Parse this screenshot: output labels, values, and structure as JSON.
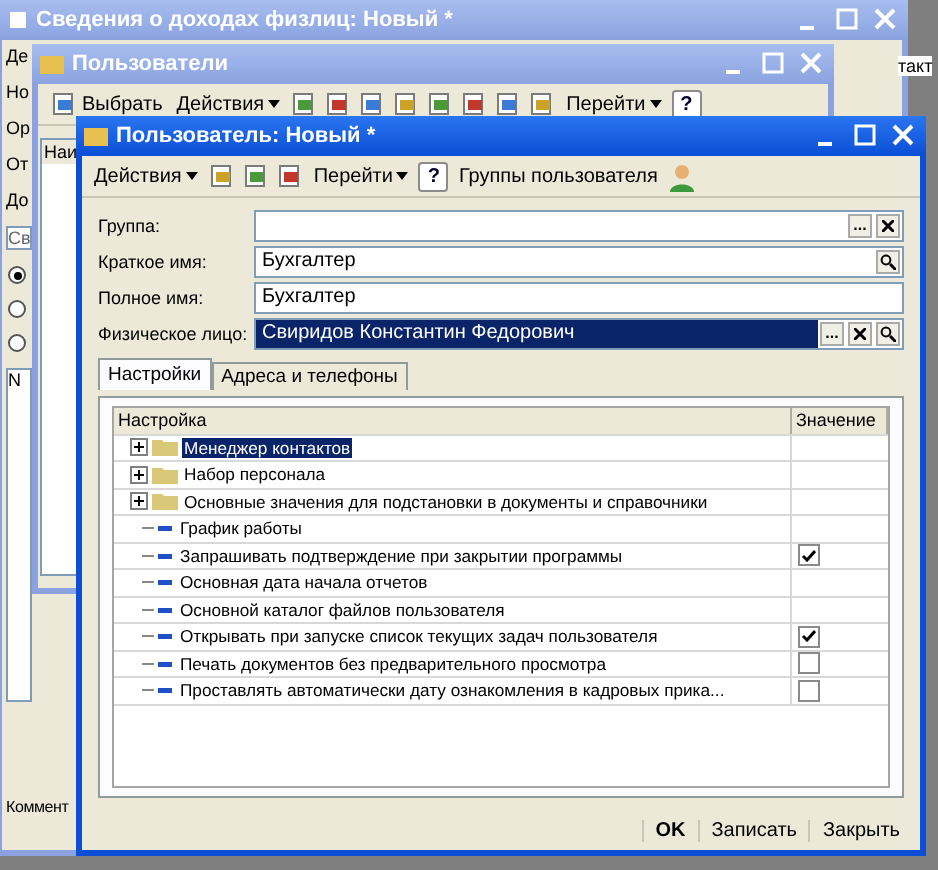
{
  "back_window": {
    "title": "Сведения о доходах физлиц: Новый *",
    "toolbar_label": "Де",
    "side_labels": [
      "Но",
      "Ор",
      "От",
      "До"
    ],
    "select_label": "Св",
    "radios": [
      {
        "selected": true
      },
      {
        "selected": false
      },
      {
        "selected": false
      }
    ],
    "list_label": "N",
    "comment_label": "Коммент",
    "right_label": "такт"
  },
  "users_window": {
    "title": "Пользователи",
    "toolbar": [
      {
        "kind": "select",
        "label": "Выбрать"
      },
      {
        "kind": "menu",
        "label": "Действия"
      },
      {
        "kind": "icon"
      },
      {
        "kind": "icon"
      },
      {
        "kind": "icon"
      },
      {
        "kind": "icon"
      },
      {
        "kind": "icon"
      },
      {
        "kind": "icon"
      },
      {
        "kind": "icon"
      },
      {
        "kind": "icon"
      },
      {
        "kind": "menu",
        "label": "Перейти"
      },
      {
        "kind": "help",
        "label": "?"
      }
    ],
    "column": "Наи"
  },
  "user_window": {
    "title": "Пользователь: Новый *",
    "toolbar": [
      {
        "kind": "menu",
        "label": "Действия"
      },
      {
        "kind": "icon"
      },
      {
        "kind": "icon"
      },
      {
        "kind": "icon"
      },
      {
        "kind": "menu",
        "label": "Перейти"
      },
      {
        "kind": "help",
        "label": "?"
      },
      {
        "kind": "text",
        "label": "Группы пользователя"
      },
      {
        "kind": "person"
      }
    ],
    "fields": [
      {
        "label": "Группа:",
        "selected": false,
        "buttons": [
          {
            "kind": "choose",
            "label": "..."
          },
          {
            "kind": "clear"
          }
        ]
      },
      {
        "label": "Краткое имя:",
        "value": "Бухгалтер",
        "selected": false,
        "buttons": [
          {
            "kind": "open"
          }
        ]
      },
      {
        "label": "Полное имя:",
        "value": "Бухгалтер",
        "selected": false
      },
      {
        "label": "Физическое лицо:",
        "value": "Свиридов Константин Федорович",
        "selected": true,
        "buttons": [
          {
            "kind": "choose",
            "label": "..."
          },
          {
            "kind": "clear"
          },
          {
            "kind": "open"
          }
        ]
      }
    ],
    "tabs": [
      {
        "label": "Настройки",
        "selected": true
      },
      {
        "label": "Адреса и телефоны",
        "selected": false
      }
    ],
    "table": {
      "columns": [
        "Настройка",
        "Значение"
      ],
      "rows": [
        {
          "kind": "group",
          "label": "Менеджер контактов",
          "expanded": false,
          "selected": true
        },
        {
          "kind": "group",
          "label": "Набор персонала",
          "expanded": false,
          "selected": false
        },
        {
          "kind": "group",
          "label": "Основные значения для подстановки в документы и справочники",
          "expanded": false,
          "selected": false
        },
        {
          "kind": "param",
          "label": "График работы",
          "selected": false
        },
        {
          "kind": "param",
          "label": "Запрашивать подтверждение при закрытии программы",
          "checked": true,
          "selected": false
        },
        {
          "kind": "param",
          "label": "Основная дата начала отчетов",
          "selected": false
        },
        {
          "kind": "param",
          "label": "Основной каталог файлов пользователя",
          "selected": false
        },
        {
          "kind": "param",
          "label": "Открывать при запуске список текущих задач пользователя",
          "checked": true,
          "selected": false
        },
        {
          "kind": "param",
          "label": "Печать документов без предварительного просмотра",
          "checked": false,
          "selected": false
        },
        {
          "kind": "param",
          "label": "Проставлять автоматически дату ознакомления в кадровых прика...",
          "checked": false,
          "selected": false
        }
      ]
    },
    "buttons": [
      {
        "label": "OK",
        "default": true
      },
      {
        "label": "Записать",
        "default": false
      },
      {
        "label": "Закрыть",
        "default": false
      }
    ]
  }
}
